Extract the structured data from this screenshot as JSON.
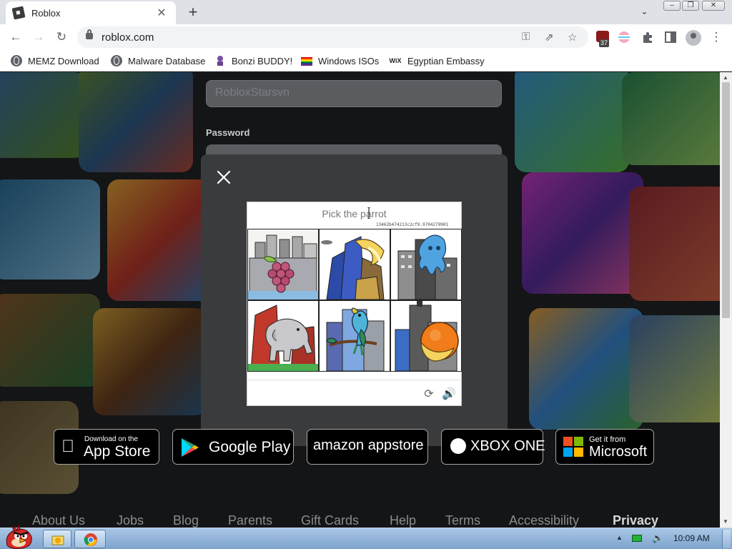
{
  "browser": {
    "tab": {
      "title": "Roblox",
      "close_glyph": "✕"
    },
    "new_tab_glyph": "+",
    "url": "roblox.com",
    "extension_badge_count": "37",
    "bookmarks": [
      {
        "label": "MEMZ Download",
        "icon": "globe-icon"
      },
      {
        "label": "Malware Database",
        "icon": "globe-icon"
      },
      {
        "label": "Bonzi BUDDY!",
        "icon": "bonzi-icon"
      },
      {
        "label": "Windows ISOs",
        "icon": "rainbow-flag-icon"
      },
      {
        "label": "Egyptian Embassy",
        "icon": "wix-icon"
      }
    ],
    "wix_text": "WiX"
  },
  "page": {
    "username_value": "RobloxStarsvn",
    "password_label": "Password",
    "store_badges": [
      {
        "small": "Download on the",
        "big": "App Store"
      },
      {
        "small": "",
        "big": "Google Play"
      },
      {
        "small": "",
        "big": "amazon appstore"
      },
      {
        "small": "",
        "big": "XBOX ONE"
      },
      {
        "small": "Get it from",
        "big": "Microsoft"
      }
    ],
    "footer_links": [
      "About Us",
      "Jobs",
      "Blog",
      "Parents",
      "Gift Cards",
      "Help",
      "Terms",
      "Accessibility",
      "Privacy"
    ]
  },
  "captcha": {
    "prompt": "Pick the parrot",
    "hash": "13462b474213c2cf9.9704279901",
    "tiles": [
      {
        "id": "grapes"
      },
      {
        "id": "banana"
      },
      {
        "id": "octopus"
      },
      {
        "id": "elephant"
      },
      {
        "id": "parrot"
      },
      {
        "id": "orange-banana"
      }
    ],
    "refresh_glyph": "⟳",
    "audio_glyph": "🔊"
  },
  "taskbar": {
    "clock": "10:09 AM"
  },
  "colors": {
    "modal_bg": "#393b3d",
    "page_bg": "#232527",
    "taskbar": "#8fb2d8"
  }
}
